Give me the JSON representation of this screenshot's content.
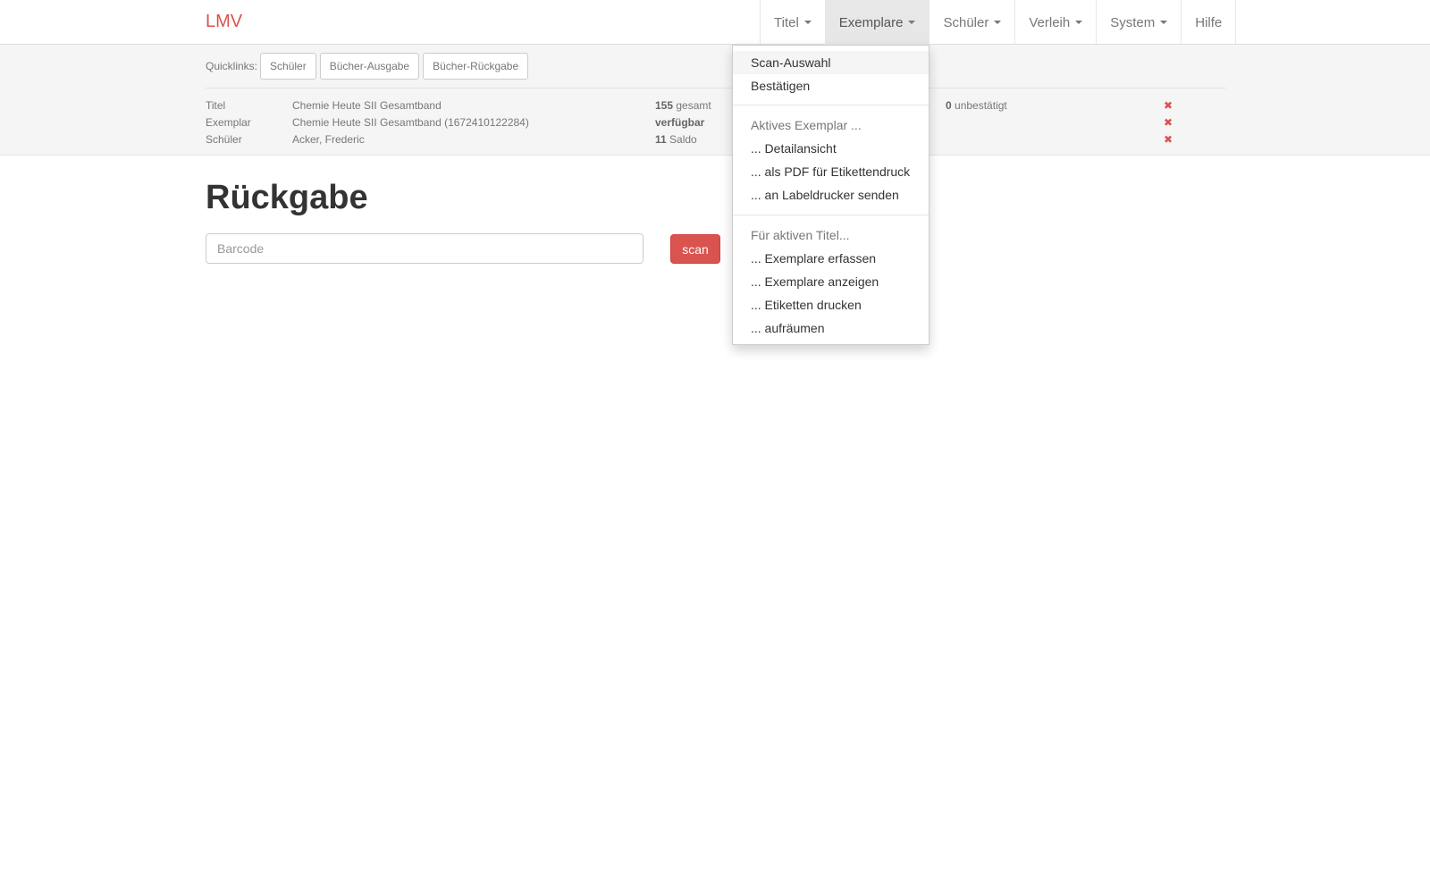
{
  "navbar": {
    "brand": "LMV",
    "items": [
      {
        "label": "Titel",
        "dropdown": true
      },
      {
        "label": "Exemplare",
        "dropdown": true,
        "active": true
      },
      {
        "label": "Schüler",
        "dropdown": true
      },
      {
        "label": "Verleih",
        "dropdown": true
      },
      {
        "label": "System",
        "dropdown": true
      },
      {
        "label": "Hilfe",
        "dropdown": false
      }
    ]
  },
  "quicklinks": {
    "label": "Quicklinks:",
    "buttons": [
      "Schüler",
      "Bücher-Ausgabe",
      "Bücher-Rückgabe"
    ]
  },
  "info": {
    "titel": {
      "label": "Titel",
      "value": "Chemie Heute SII Gesamtband",
      "stat_num": "155",
      "stat_text": "gesamt",
      "stat2_num": "0",
      "stat2_text": "unbestätigt"
    },
    "exemplar": {
      "label": "Exemplar",
      "value": "Chemie Heute SII Gesamtband (1672410122284)",
      "stat": "verfügbar"
    },
    "schueler": {
      "label": "Schüler",
      "value": "Acker, Frederic",
      "stat_num": "11",
      "stat_text": "Saldo"
    },
    "remove_icon": "✖"
  },
  "main": {
    "title": "Rückgabe",
    "barcode_placeholder": "Barcode",
    "scan_label": "scan"
  },
  "dropdown": {
    "items": [
      "Scan-Auswahl",
      "Bestätigen"
    ],
    "header1": "Aktives Exemplar ...",
    "group1": [
      "... Detailansicht",
      "... als PDF für Etikettendruck",
      "... an Labeldrucker senden"
    ],
    "header2": "Für aktiven Titel...",
    "group2": [
      "... Exemplare erfassen",
      "... Exemplare anzeigen",
      "... Etiketten drucken",
      "... aufräumen"
    ]
  },
  "colors": {
    "accent": "#d9534f",
    "active_nav": "#e7e7e7",
    "infobar_bg": "#f5f5f5"
  }
}
